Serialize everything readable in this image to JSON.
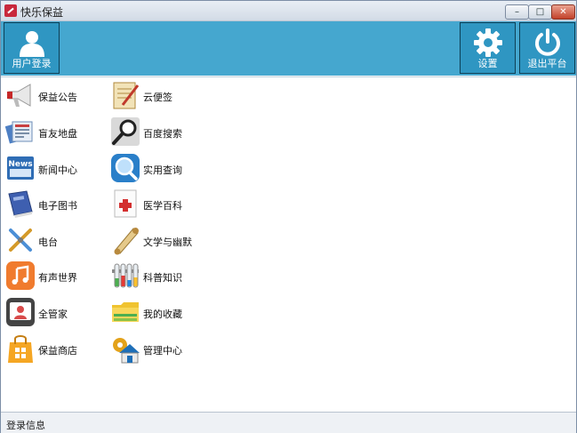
{
  "window": {
    "title": "快乐保益",
    "controls": {
      "minimize": "–",
      "maximize": "□",
      "close": "✕"
    }
  },
  "toolbar": {
    "login_label": "用户登录",
    "settings_label": "设置",
    "exit_label": "退出平台",
    "background_color": "#45a7cf"
  },
  "menu_left": [
    {
      "label": "保益公告",
      "icon": "megaphone-icon"
    },
    {
      "label": "盲友地盘",
      "icon": "newspapers-icon"
    },
    {
      "label": "新闻中心",
      "icon": "news-icon"
    },
    {
      "label": "电子图书",
      "icon": "book-icon"
    },
    {
      "label": "电台",
      "icon": "radio-tools-icon"
    },
    {
      "label": "有声世界",
      "icon": "music-note-icon"
    },
    {
      "label": "全管家",
      "icon": "user-card-icon"
    },
    {
      "label": "保益商店",
      "icon": "shopping-bag-icon"
    }
  ],
  "menu_right": [
    {
      "label": "云便签",
      "icon": "notepad-icon"
    },
    {
      "label": "百度搜索",
      "icon": "magnifier-icon"
    },
    {
      "label": "实用查询",
      "icon": "blue-magnifier-icon"
    },
    {
      "label": "医学百科",
      "icon": "medical-note-icon"
    },
    {
      "label": "文学与幽默",
      "icon": "scroll-icon"
    },
    {
      "label": "科普知识",
      "icon": "test-tubes-icon"
    },
    {
      "label": "我的收藏",
      "icon": "folder-icon"
    },
    {
      "label": "管理中心",
      "icon": "house-gear-icon"
    }
  ],
  "statusbar": {
    "text": "登录信息"
  }
}
